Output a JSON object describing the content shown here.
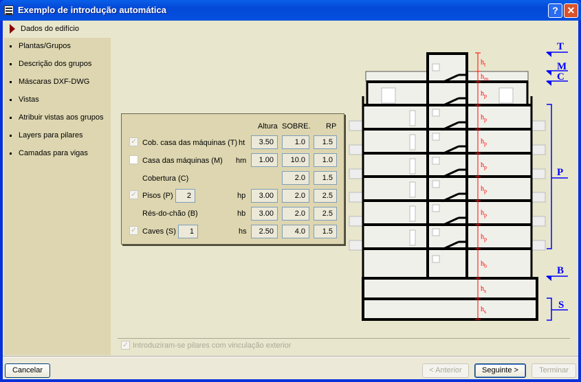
{
  "window": {
    "title": "Exemplo de introdução automática",
    "help": "?",
    "close": "✕"
  },
  "sidebar": {
    "active": "Dados do edifício",
    "items": [
      "Plantas/Grupos",
      "Descrição dos grupos",
      "Máscaras DXF-DWG",
      "Vistas",
      "Atribuir vistas aos grupos",
      "Layers para pilares",
      "Camadas para vigas"
    ]
  },
  "form": {
    "headers": {
      "altura": "Altura",
      "sobre": "SOBRE.",
      "rp": "RP"
    },
    "rows": [
      {
        "label": "Cob. casa das máquinas (T)",
        "checked": true,
        "sym": "ht",
        "altura": "3.50",
        "sobre": "1.0",
        "rp": "1.5"
      },
      {
        "label": "Casa das máquinas (M)",
        "checked": false,
        "sym": "hm",
        "altura": "1.00",
        "sobre": "10.0",
        "rp": "1.0"
      },
      {
        "label": "Cobertura (C)",
        "sym": "",
        "sobre": "2.0",
        "rp": "1.5"
      },
      {
        "label": "Pisos (P)",
        "checked": true,
        "count": "2",
        "sym": "hp",
        "altura": "3.00",
        "sobre": "2.0",
        "rp": "2.5"
      },
      {
        "label": "Rés-do-chão (B)",
        "sym": "hb",
        "altura": "3.00",
        "sobre": "2.0",
        "rp": "2.5"
      },
      {
        "label": "Caves (S)",
        "checked": true,
        "count": "1",
        "sym": "hs",
        "altura": "2.50",
        "sobre": "4.0",
        "rp": "1.5"
      }
    ]
  },
  "diagram": {
    "levels": {
      "T": "T",
      "M": "M",
      "C": "C",
      "P": "P",
      "B": "B",
      "S": "S"
    },
    "dims": [
      {
        "h": "h",
        "sub": "t"
      },
      {
        "h": "h",
        "sub": "m"
      },
      {
        "h": "h",
        "sub": "p"
      },
      {
        "h": "h",
        "sub": "p"
      },
      {
        "h": "h",
        "sub": "p"
      },
      {
        "h": "h",
        "sub": "p"
      },
      {
        "h": "h",
        "sub": "p"
      },
      {
        "h": "h",
        "sub": "p"
      },
      {
        "h": "h",
        "sub": "p"
      },
      {
        "h": "h",
        "sub": "b"
      },
      {
        "h": "h",
        "sub": "s"
      },
      {
        "h": "h",
        "sub": "s"
      }
    ],
    "dim_color": "#ff0000",
    "level_color": "#0000ff"
  },
  "ext_pillars": {
    "label": "Introduziram-se pilares com vinculação exterior",
    "checked": true
  },
  "buttons": {
    "cancel": "Cancelar",
    "prev": "< Anterior",
    "next": "Seguinte >",
    "finish": "Terminar"
  }
}
